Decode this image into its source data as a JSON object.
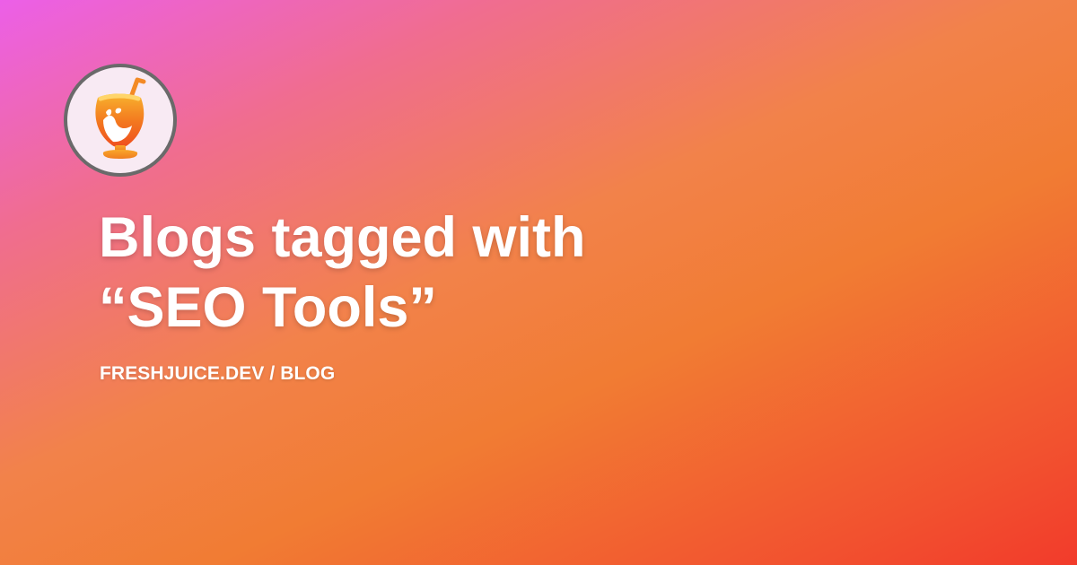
{
  "card": {
    "logo_icon": "juice-glass-icon",
    "title_line_1": "Blogs tagged with",
    "title_line_2": "“SEO Tools”",
    "breadcrumb": "FRESHJUICE.DEV / BLOG"
  },
  "colors": {
    "gradient_top_left": "#ec5fe8",
    "gradient_middle": "#f17c33",
    "gradient_bottom_right": "#f23b2b",
    "text": "#ffffff",
    "logo_background": "#f8eaf3",
    "logo_border": "#6a6a6a"
  }
}
